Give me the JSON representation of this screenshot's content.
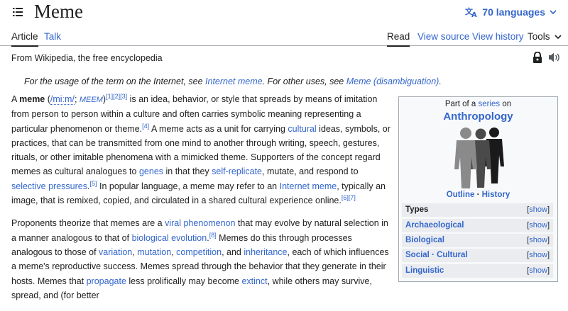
{
  "header": {
    "title": "Meme",
    "languages": "70 languages"
  },
  "tabs": {
    "article": "Article",
    "talk": "Talk",
    "read": "Read",
    "view_source": "View source",
    "view_history": "View history",
    "tools": "Tools"
  },
  "tagline": "From Wikipedia, the free encyclopedia",
  "hatnote": {
    "t1": "For the usage of the term on the Internet, see ",
    "l1": "Internet meme",
    "t2": ". For other uses, see ",
    "l2": "Meme (disambiguation)",
    "t3": "."
  },
  "p1": {
    "a": "A ",
    "meme": "meme",
    "b": " (",
    "ipa": "/miːm/",
    "c": "; ",
    "resp": "MEEM",
    "d": ")",
    "refs1": "[1][2][3]",
    "e": " is an idea, behavior, or style that spreads by means of imitation from person to person within a culture and often carries symbolic meaning representing a particular phenomenon or theme.",
    "ref4": "[4]",
    "f": " A meme acts as a unit for carrying ",
    "cultural": "cultural",
    "g": " ideas, symbols, or practices, that can be transmitted from one mind to another through writing, speech, gestures, rituals, or other imitable phenomena with a mimicked theme. Supporters of the concept regard memes as cultural analogues to ",
    "genes": "genes",
    "h": " in that they ",
    "selfrep": "self-replicate",
    "i": ", mutate, and respond to ",
    "selective": "selective pressures",
    "j": ".",
    "ref5": "[5]",
    "k": " In popular language, a meme may refer to an ",
    "internet_meme": "Internet meme",
    "l": ", typically an image, that is remixed, copied, and circulated in a shared cultural experience online.",
    "ref67": "[6][7]"
  },
  "p2": {
    "a": "Proponents theorize that memes are a ",
    "viral": "viral phenomenon",
    "b": " that may evolve by natural selection in a manner analogous to that of ",
    "bioevo": "biological evolution",
    "c": ".",
    "ref8": "[8]",
    "d": " Memes do this through processes analogous to those of ",
    "variation": "variation",
    "e": ", ",
    "mutation": "mutation",
    "f": ", ",
    "competition": "competition",
    "g": ", and ",
    "inheritance": "inheritance",
    "h": ", each of which influences a meme's reproductive success. Memes spread through the behavior that they generate in their hosts. Memes that ",
    "propagate": "propagate",
    "i": " less prolifically may become ",
    "extinct": "extinct",
    "j": ", while others may survive, spread, and (for better"
  },
  "infobox": {
    "part_of": "Part of a ",
    "series": "series",
    "on": " on",
    "title": "Anthropology",
    "outline": "Outline",
    "sep": " · ",
    "history": "History",
    "rows": [
      {
        "label": "Types",
        "show": "show"
      },
      {
        "label": "Archaeological",
        "show": "show"
      },
      {
        "label": "Biological",
        "show": "show"
      },
      {
        "label": "Social · Cultural",
        "show": "show"
      },
      {
        "label": "Linguistic",
        "show": "show"
      }
    ]
  },
  "colors": {
    "link": "#3366cc",
    "text": "#202122",
    "border": "#a2a9b1",
    "infobox_bg": "#f8f9fa",
    "row_bg": "#eaecf0"
  }
}
